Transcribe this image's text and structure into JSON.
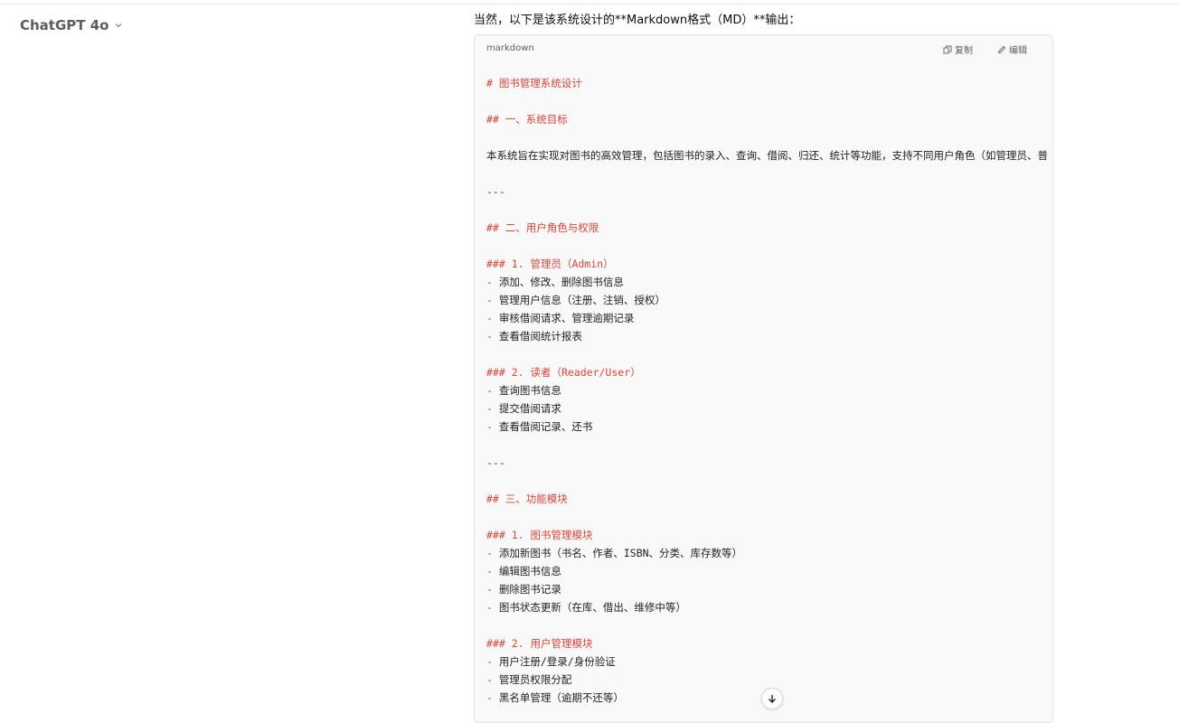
{
  "header": {
    "model_name": "ChatGPT 4o"
  },
  "message": {
    "intro": "当然，以下是该系统设计的**Markdown格式（MD）**输出："
  },
  "code_block": {
    "language": "markdown",
    "copy_label": "复制",
    "edit_label": "编辑",
    "lines": [
      {
        "kind": "h",
        "text": "# 图书管理系统设计"
      },
      {
        "kind": "blank",
        "text": ""
      },
      {
        "kind": "h",
        "text": "## 一、系统目标"
      },
      {
        "kind": "blank",
        "text": ""
      },
      {
        "kind": "txt",
        "text": "本系统旨在实现对图书的高效管理，包括图书的录入、查询、借阅、归还、统计等功能，支持不同用户角色（如管理员、普"
      },
      {
        "kind": "blank",
        "text": ""
      },
      {
        "kind": "hr",
        "text": "---"
      },
      {
        "kind": "blank",
        "text": ""
      },
      {
        "kind": "h",
        "text": "## 二、用户角色与权限"
      },
      {
        "kind": "blank",
        "text": ""
      },
      {
        "kind": "h",
        "text": "### 1. 管理员（Admin）"
      },
      {
        "kind": "li",
        "text": "添加、修改、删除图书信息"
      },
      {
        "kind": "li",
        "text": "管理用户信息（注册、注销、授权）"
      },
      {
        "kind": "li",
        "text": "审核借阅请求、管理逾期记录"
      },
      {
        "kind": "li",
        "text": "查看借阅统计报表"
      },
      {
        "kind": "blank",
        "text": ""
      },
      {
        "kind": "h",
        "text": "### 2. 读者（Reader/User）"
      },
      {
        "kind": "li",
        "text": "查询图书信息"
      },
      {
        "kind": "li",
        "text": "提交借阅请求"
      },
      {
        "kind": "li",
        "text": "查看借阅记录、还书"
      },
      {
        "kind": "blank",
        "text": ""
      },
      {
        "kind": "hr",
        "text": "---"
      },
      {
        "kind": "blank",
        "text": ""
      },
      {
        "kind": "h",
        "text": "## 三、功能模块"
      },
      {
        "kind": "blank",
        "text": ""
      },
      {
        "kind": "h",
        "text": "### 1. 图书管理模块"
      },
      {
        "kind": "li",
        "text": "添加新图书（书名、作者、ISBN、分类、库存数等）"
      },
      {
        "kind": "li",
        "text": "编辑图书信息"
      },
      {
        "kind": "li",
        "text": "删除图书记录"
      },
      {
        "kind": "li",
        "text": "图书状态更新（在库、借出、维修中等）"
      },
      {
        "kind": "blank",
        "text": ""
      },
      {
        "kind": "h",
        "text": "### 2. 用户管理模块"
      },
      {
        "kind": "li",
        "text": "用户注册/登录/身份验证"
      },
      {
        "kind": "li",
        "text": "管理员权限分配"
      },
      {
        "kind": "li",
        "text": "黑名单管理（逾期不还等）"
      }
    ]
  },
  "icons": {
    "model_chevron": "chevron-down-icon",
    "copy": "copy-icon",
    "edit": "edit-icon",
    "scroll": "arrow-down-icon"
  }
}
